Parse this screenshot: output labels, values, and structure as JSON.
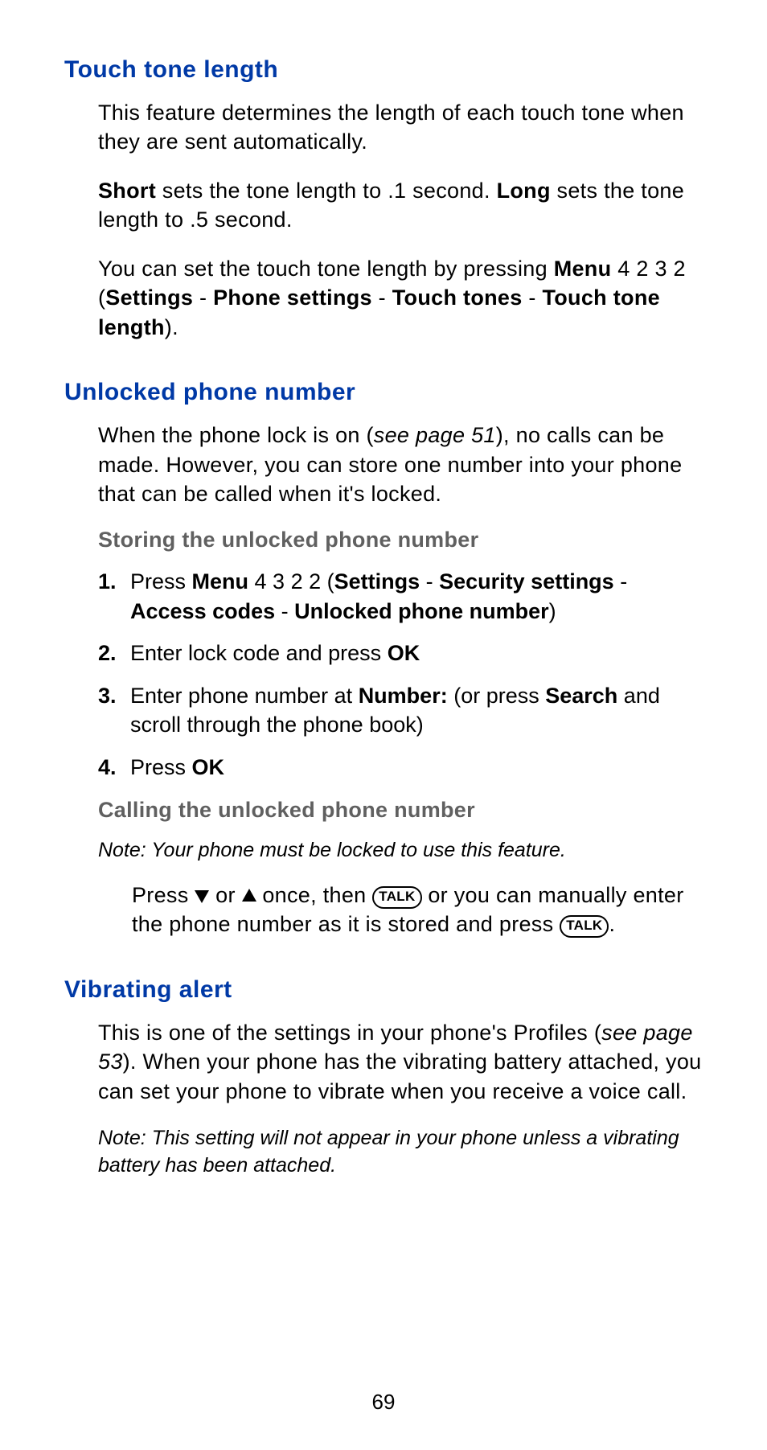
{
  "s1": {
    "title": "Touch tone length",
    "p1": "This feature determines the length of each touch tone when they are sent automatically.",
    "p2_a": "Short",
    "p2_b": " sets the tone length to .1 second. ",
    "p2_c": "Long",
    "p2_d": " sets the tone length to .5 second.",
    "p3_a": "You can set the touch tone length by pressing ",
    "p3_b": "Menu",
    "p3_c": " 4 2 3 2 (",
    "p3_d": "Settings",
    "p3_e": " - ",
    "p3_f": "Phone settings",
    "p3_g": " - ",
    "p3_h": "Touch tones",
    "p3_i": " - ",
    "p3_j": "Touch tone length",
    "p3_k": ")."
  },
  "s2": {
    "title": "Unlocked phone number",
    "p1_a": "When the phone lock is on (",
    "p1_b": "see page 51",
    "p1_c": "), no calls can be made. However, you can store one number into your phone that can be called when it's locked.",
    "sub1": "Storing the unlocked phone number",
    "steps": {
      "n1": "1.",
      "s1_a": "Press ",
      "s1_b": "Menu",
      "s1_c": " 4 3 2 2 (",
      "s1_d": "Settings",
      "s1_e": " - ",
      "s1_f": "Security settings",
      "s1_g": " - ",
      "s1_h": "Access codes",
      "s1_i": " - ",
      "s1_j": "Unlocked phone number",
      "s1_k": ")",
      "n2": "2.",
      "s2_a": "Enter lock code and press ",
      "s2_b": "OK",
      "n3": "3.",
      "s3_a": "Enter phone number at ",
      "s3_b": "Number:",
      "s3_c": " (or press ",
      "s3_d": "Search",
      "s3_e": " and scroll through the phone book)",
      "n4": "4.",
      "s4_a": "Press ",
      "s4_b": "OK"
    },
    "sub2": "Calling the unlocked phone number",
    "note": "Note: Your phone must be locked to use this feature.",
    "p2_a": "Press ",
    "p2_b": " or ",
    "p2_c": " once, then ",
    "p2_talk": "TALK",
    "p2_d": " or you can manually enter the phone number as it is stored and press ",
    "p2_e": "."
  },
  "s3": {
    "title": "Vibrating alert",
    "p1_a": "This is one of the settings in your phone's Profiles (",
    "p1_b": "see page 53",
    "p1_c": "). When your phone has the vibrating battery attached, you can set your phone to vibrate when you receive a voice call.",
    "note": "Note: This setting will not appear in your phone unless a vibrating battery has been attached."
  },
  "page_number": "69"
}
